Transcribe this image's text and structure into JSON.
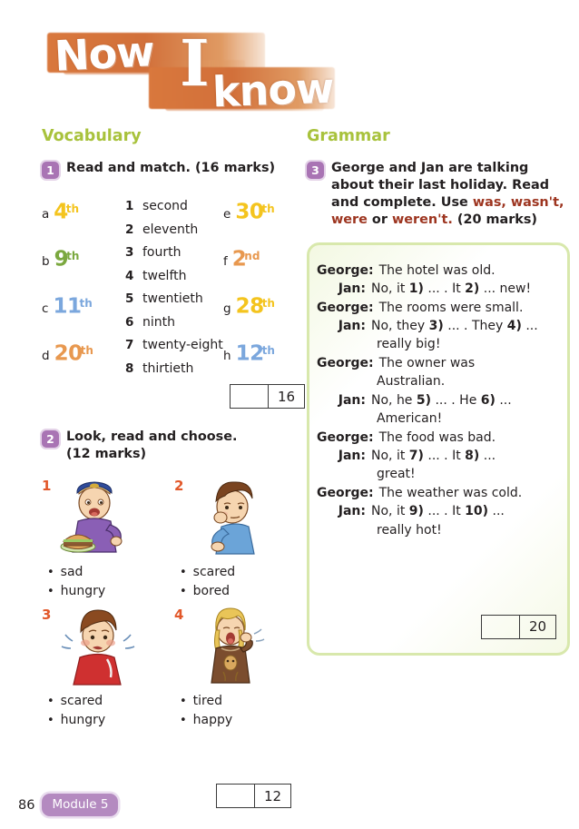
{
  "title": {
    "word1": "Now",
    "word2": "I",
    "word3": "know"
  },
  "vocabulary": {
    "heading": "Vocabulary",
    "exercise1": {
      "badge": "1",
      "title": "Read and match. (16 marks)",
      "ordinals": [
        {
          "letter": "a",
          "num": "4",
          "suffix": "th",
          "color": "yellow"
        },
        {
          "letter": "b",
          "num": "9",
          "suffix": "th",
          "color": "green"
        },
        {
          "letter": "c",
          "num": "11",
          "suffix": "th",
          "color": "blue"
        },
        {
          "letter": "d",
          "num": "20",
          "suffix": "th",
          "color": "orange"
        },
        {
          "letter": "e",
          "num": "30",
          "suffix": "th",
          "color": "yellow"
        },
        {
          "letter": "f",
          "num": "2",
          "suffix": "nd",
          "color": "orange"
        },
        {
          "letter": "g",
          "num": "28",
          "suffix": "th",
          "color": "yellow"
        },
        {
          "letter": "h",
          "num": "12",
          "suffix": "th",
          "color": "blue"
        }
      ],
      "words": [
        {
          "n": "1",
          "text": "second"
        },
        {
          "n": "2",
          "text": "eleventh"
        },
        {
          "n": "3",
          "text": "fourth"
        },
        {
          "n": "4",
          "text": "twelfth"
        },
        {
          "n": "5",
          "text": "twentieth"
        },
        {
          "n": "6",
          "text": "ninth"
        },
        {
          "n": "7",
          "text": "twenty-eight"
        },
        {
          "n": "8",
          "text": "thirtieth"
        }
      ],
      "score_total": "16"
    },
    "exercise2": {
      "badge": "2",
      "title": "Look, read and choose.",
      "title_line2": "(12 marks)",
      "pictures": [
        {
          "num": "1",
          "scene": "boy-eating-burger",
          "options": [
            "sad",
            "hungry"
          ]
        },
        {
          "num": "2",
          "scene": "bored-boy-head-on-hand",
          "options": [
            "scared",
            "bored"
          ]
        },
        {
          "num": "3",
          "scene": "scared-boy-red-shirt",
          "options": [
            "scared",
            "hungry"
          ]
        },
        {
          "num": "4",
          "scene": "girl-yawning-nightgown",
          "options": [
            "tired",
            "happy"
          ]
        }
      ],
      "score_total": "12"
    }
  },
  "grammar": {
    "heading": "Grammar",
    "exercise3": {
      "badge": "3",
      "title_part1": "George and Jan are talking about their last holiday. Read and complete. Use ",
      "title_highlight1": "was, wasn't, were",
      "title_mid": " or ",
      "title_highlight2": "weren't.",
      "title_part2": " (20 marks)",
      "dialogue": [
        {
          "speaker": "George:",
          "text": "The hotel was old.",
          "cont": ""
        },
        {
          "speaker": "Jan:",
          "text": "No, it 1) ... . It 2) ... new!",
          "cont": ""
        },
        {
          "speaker": "George:",
          "text": "The rooms were small.",
          "cont": ""
        },
        {
          "speaker": "Jan:",
          "text": "No, they 3) ... . They 4) ...",
          "cont": "really big!"
        },
        {
          "speaker": "George:",
          "text": "The owner was",
          "cont": "Australian."
        },
        {
          "speaker": "Jan:",
          "text": "No, he 5) ... . He 6) ...",
          "cont": "American!"
        },
        {
          "speaker": "George:",
          "text": "The food was bad.",
          "cont": ""
        },
        {
          "speaker": "Jan:",
          "text": "No, it 7) ... . It 8) ...",
          "cont": "great!"
        },
        {
          "speaker": "George:",
          "text": "The weather was cold.",
          "cont": ""
        },
        {
          "speaker": "Jan:",
          "text": "No, it 9) ... . It 10) ...",
          "cont": "really hot!"
        }
      ],
      "score_total": "20"
    }
  },
  "footer": {
    "page": "86",
    "module": "Module 5"
  }
}
